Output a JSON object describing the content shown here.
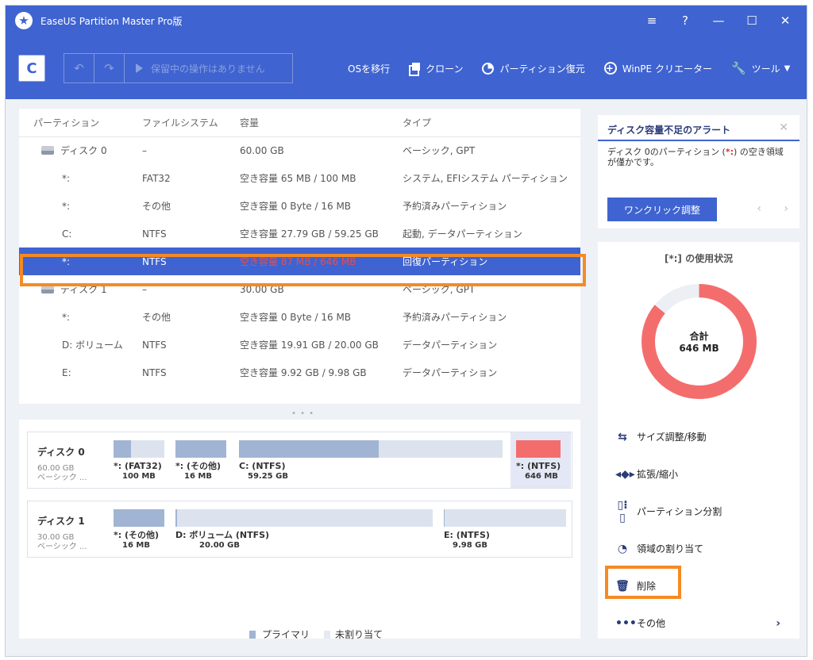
{
  "app": {
    "title": "EaseUS Partition Master Pro版",
    "controls": {
      "menu": "≡",
      "help": "?",
      "minimize": "—",
      "maximize": "☐",
      "close": "✕"
    }
  },
  "toolbar": {
    "refresh": "C",
    "undo": "↶",
    "redo": "↷",
    "pending": "保留中の操作はありません",
    "items": [
      {
        "icon": "windows-icon",
        "label": "OSを移行"
      },
      {
        "icon": "clone-icon",
        "label": "クローン"
      },
      {
        "icon": "pie-icon",
        "label": "パーティション復元"
      },
      {
        "icon": "plus-circle-icon",
        "label": "WinPE クリエーター"
      },
      {
        "icon": "wrench-icon",
        "label": "ツール"
      }
    ]
  },
  "table": {
    "headers": [
      "パーティション",
      "ファイルシステム",
      "容量",
      "タイプ"
    ],
    "rows": [
      {
        "name": "ディスク 0",
        "fs": "–",
        "cap": "60.00 GB",
        "type": "ベーシック, GPT",
        "disk": true
      },
      {
        "name": "*:",
        "fs": "FAT32",
        "cap": "空き容量 65 MB / 100 MB",
        "type": "システム, EFIシステム パーティション"
      },
      {
        "name": "*:",
        "fs": "その他",
        "cap": "空き容量 0 Byte / 16 MB",
        "type": "予約済みパーティション"
      },
      {
        "name": "C:",
        "fs": "NTFS",
        "cap": "空き容量 27.79 GB / 59.25 GB",
        "type": "起動, データパーティション"
      },
      {
        "name": "*:",
        "fs": "NTFS",
        "cap": "空き容量 87 MB / 646 MB",
        "type": "回復パーティション",
        "selected": true
      },
      {
        "name": "ディスク 1",
        "fs": "–",
        "cap": "30.00 GB",
        "type": "ベーシック, GPT",
        "disk": true
      },
      {
        "name": "*:",
        "fs": "その他",
        "cap": "空き容量 0 Byte / 16 MB",
        "type": "予約済みパーティション"
      },
      {
        "name": "D: ボリューム",
        "fs": "NTFS",
        "cap": "空き容量 19.91 GB / 20.00 GB",
        "type": "データパーティション"
      },
      {
        "name": "E:",
        "fs": "NTFS",
        "cap": "空き容量 9.92 GB / 9.98 GB",
        "type": "データパーティション"
      }
    ]
  },
  "diskmap": {
    "disk0": {
      "name": "ディスク 0",
      "size": "60.00 GB",
      "type": "ベーシック ...",
      "parts": [
        {
          "label": "*: (FAT32)",
          "size": "100 MB",
          "used_fraction": 0.35
        },
        {
          "label": "*: (その他)",
          "size": "16 MB",
          "used_fraction": 1.0
        },
        {
          "label": "C: (NTFS)",
          "size": "59.25 GB",
          "used_fraction": 0.53
        },
        {
          "label": "*: (NTFS)",
          "size": "646 MB",
          "used_fraction": 1.0
        }
      ]
    },
    "disk1": {
      "name": "ディスク 1",
      "size": "30.00 GB",
      "type": "ベーシック ...",
      "parts": [
        {
          "label": "*: (その他)",
          "size": "16 MB",
          "used_fraction": 1.0
        },
        {
          "label": "D: ボリューム (NTFS)",
          "size": "20.00 GB",
          "used_fraction": 0.005
        },
        {
          "label": "E: (NTFS)",
          "size": "9.98 GB",
          "used_fraction": 0.006
        }
      ]
    },
    "legend": {
      "primary": "プライマリ",
      "unallocated": "未割り当て"
    }
  },
  "alert": {
    "title": "ディスク容量不足のアラート",
    "close": "✕",
    "body_pre": "ディスク 0のパーティション (",
    "body_hl": "*:",
    "body_post": ") の空き領域が僅かです。",
    "button": "ワンクリック調整",
    "prev": "‹",
    "next": "›"
  },
  "usage": {
    "title": "[*:] の使用状況",
    "total_label": "合計",
    "total_value": "646 MB",
    "used_fraction": 0.86
  },
  "ops": [
    {
      "icon": "resize-icon",
      "label": "サイズ調整/移動"
    },
    {
      "icon": "extend-icon",
      "label": "拡張/縮小"
    },
    {
      "icon": "split-icon",
      "label": "パーティション分割"
    },
    {
      "icon": "allocate-icon",
      "label": "領域の割り当て"
    },
    {
      "icon": "trash-icon",
      "label": "削除"
    },
    {
      "icon": "more-icon",
      "label": "その他"
    }
  ],
  "colors": {
    "accent": "#3f63d0",
    "highlight": "#f58a24",
    "alert_red": "#f46d6d"
  }
}
